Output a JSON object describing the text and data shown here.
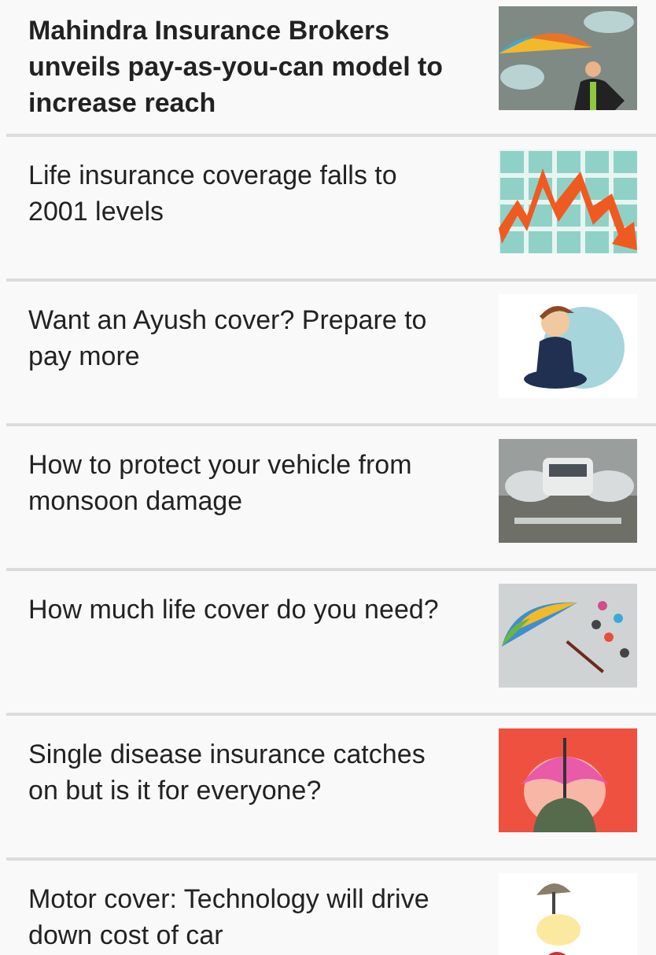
{
  "articles": [
    {
      "headline": "Mahindra Insurance Brokers unveils pay-as-you-can model to increase reach",
      "kind": "featured"
    },
    {
      "headline": "Life insurance coverage falls to 2001 levels",
      "kind": "regular"
    },
    {
      "headline": "Want an Ayush cover? Prepare to pay more",
      "kind": "regular"
    },
    {
      "headline": "How to protect your vehicle from monsoon damage",
      "kind": "regular"
    },
    {
      "headline": "How much life cover do you need?",
      "kind": "regular"
    },
    {
      "headline": "Single disease insurance catches on but is it for everyone?",
      "kind": "regular"
    },
    {
      "headline": "Motor cover: Technology will drive down cost of car",
      "kind": "regular"
    }
  ]
}
